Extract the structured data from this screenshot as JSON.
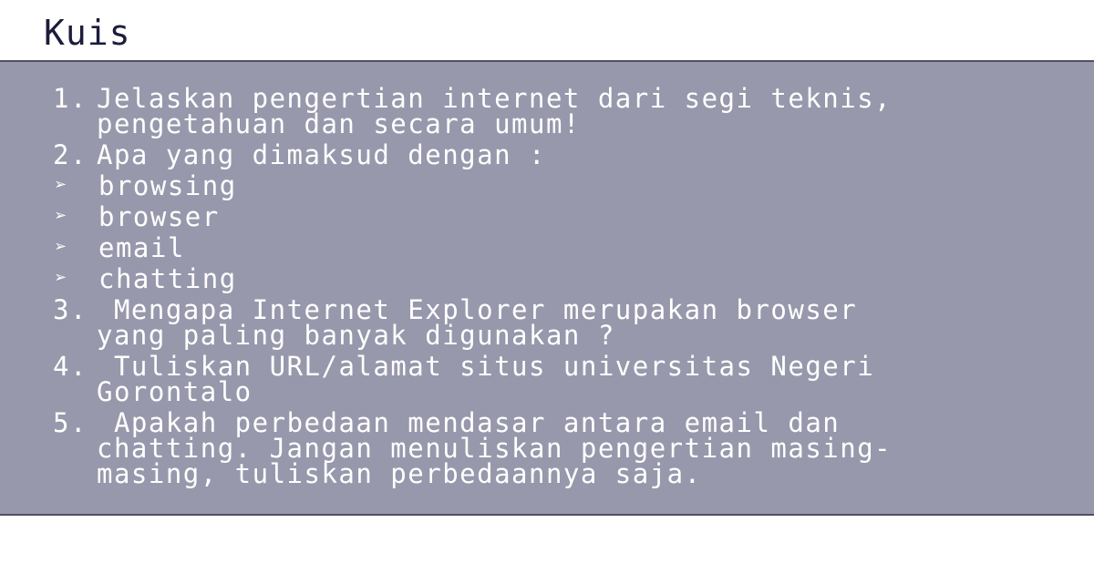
{
  "title": "Kuis",
  "items": [
    {
      "num": "1.",
      "text": "Jelaskan pengertian internet dari segi teknis,\npengetahuan dan secara umum!"
    },
    {
      "num": "2.",
      "text": "Apa yang dimaksud dengan :"
    },
    {
      "bullet": "➢",
      "text": "browsing"
    },
    {
      "bullet": "➢",
      "text": "browser"
    },
    {
      "bullet": "➢",
      "text": "email"
    },
    {
      "bullet": "➢",
      "text": "chatting"
    },
    {
      "num": "3.",
      "text": " Mengapa Internet Explorer merupakan browser\nyang paling banyak digunakan ?"
    },
    {
      "num": "4.",
      "text": " Tuliskan URL/alamat situs universitas Negeri\nGorontalo"
    },
    {
      "num": "5.",
      "text": " Apakah perbedaan mendasar antara email dan\nchatting. Jangan menuliskan pengertian masing-\nmasing, tuliskan perbedaannya saja."
    }
  ]
}
